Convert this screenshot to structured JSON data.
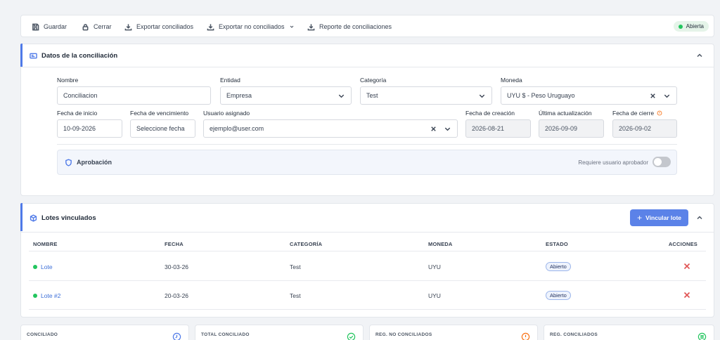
{
  "toolbar": {
    "save": "Guardar",
    "close": "Cerrar",
    "export_reconciled": "Exportar conciliados",
    "export_unreconciled": "Exportar no conciliados",
    "report": "Reporte de conciliaciones",
    "status": "Abierta",
    "status_color": "#22c55e"
  },
  "details": {
    "title": "Datos de la conciliación",
    "nombre": {
      "label": "Nombre",
      "value": "Conciliacion"
    },
    "entidad": {
      "label": "Entidad",
      "value": "Empresa"
    },
    "categoria": {
      "label": "Categoría",
      "value": "Test"
    },
    "moneda": {
      "label": "Moneda",
      "value": "UYU $ - Peso Uruguayo"
    },
    "fecha_inicio": {
      "label": "Fecha de inicio",
      "value": "10-09-2026"
    },
    "fecha_vencimiento": {
      "label": "Fecha de vencimiento",
      "placeholder": "Seleccione fecha"
    },
    "usuario": {
      "label": "Usuario asignado",
      "value": "ejemplo@user.com"
    },
    "fecha_creacion": {
      "label": "Fecha de creación",
      "value": "2026-08-21"
    },
    "ultima_actualizacion": {
      "label": "Última actualización",
      "value": "2026-09-09"
    },
    "fecha_cierre": {
      "label": "Fecha de cierre",
      "value": "2026-09-02"
    },
    "approval": {
      "title": "Aprobación",
      "toggle_label": "Requiere usuario aprobador",
      "toggle_on": false
    }
  },
  "lotes": {
    "title": "Lotes vinculados",
    "add_button": "Vincular lote",
    "accent": "#5b82e8",
    "columns": [
      "NOMBRE",
      "FECHA",
      "CATEGORÍA",
      "MONEDA",
      "ESTADO",
      "ACCIONES"
    ],
    "rows": [
      {
        "nombre": "Lote",
        "fecha": "30-03-26",
        "categoria": "Test",
        "moneda": "UYU",
        "estado": "Abierto"
      },
      {
        "nombre": "Lote #2",
        "fecha": "20-03-26",
        "categoria": "Test",
        "moneda": "UYU",
        "estado": "Abierto"
      }
    ]
  },
  "stats": [
    {
      "title": "CONCILIADO",
      "icon": "clock-icon",
      "color": "#4f7ae8"
    },
    {
      "title": "TOTAL CONCILIADO",
      "icon": "check-circle-icon",
      "color": "#22c55e"
    },
    {
      "title": "REG. NO CONCILIADOS",
      "icon": "alert-circle-icon",
      "color": "#f97316"
    },
    {
      "title": "REG. CONCILIADOS",
      "icon": "list-icon",
      "color": "#22c55e"
    }
  ]
}
